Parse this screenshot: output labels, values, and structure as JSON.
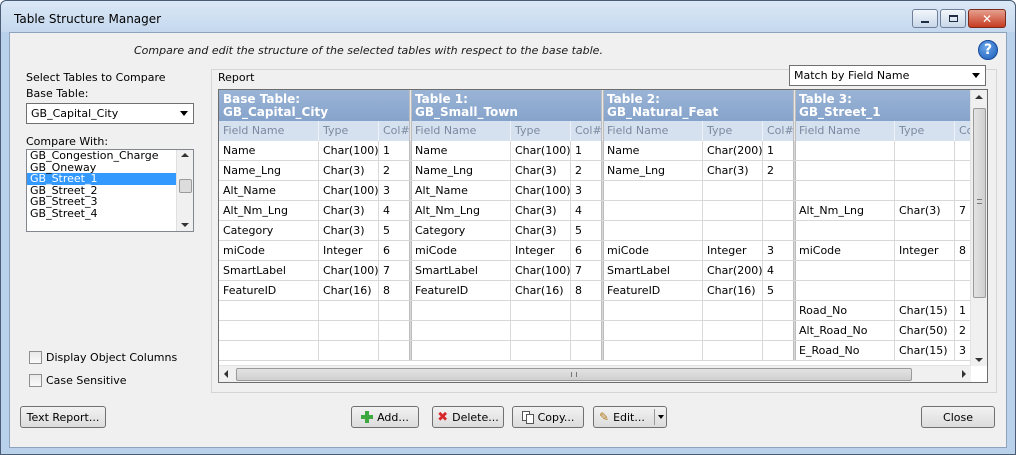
{
  "window": {
    "title": "Table Structure Manager"
  },
  "subtitle": "Compare and edit the structure of the selected tables with respect to the base table.",
  "left": {
    "select_label": "Select Tables to Compare",
    "base_table_label": "Base Table:",
    "base_table_value": "GB_Capital_City",
    "compare_with_label": "Compare With:",
    "compare_items": [
      "GB_Congestion_Charge",
      "GB_Oneway",
      "GB_Street_1",
      "GB_Street_2",
      "GB_Street_3",
      "GB_Street_4"
    ],
    "selected_item": "GB_Street_1",
    "display_object_columns": "Display Object Columns",
    "case_sensitive": "Case Sensitive"
  },
  "report": {
    "label": "Report",
    "match_by": "Match by Field Name",
    "tables": [
      {
        "title": "Base Table:",
        "name": "GB_Capital_City"
      },
      {
        "title": "Table 1:",
        "name": "GB_Small_Town"
      },
      {
        "title": "Table 2:",
        "name": "GB_Natural_Feat"
      },
      {
        "title": "Table 3:",
        "name": "GB_Street_1"
      }
    ],
    "columns": {
      "field": "Field Name",
      "type": "Type",
      "col": "Col#",
      "col_cut": "Co"
    },
    "rows": [
      [
        [
          "Name",
          "Char(100)",
          "1"
        ],
        [
          "Name",
          "Char(100)",
          "1"
        ],
        [
          "Name",
          "Char(200)",
          "1"
        ],
        [
          "",
          "",
          ""
        ]
      ],
      [
        [
          "Name_Lng",
          "Char(3)",
          "2"
        ],
        [
          "Name_Lng",
          "Char(3)",
          "2"
        ],
        [
          "Name_Lng",
          "Char(3)",
          "2"
        ],
        [
          "",
          "",
          ""
        ]
      ],
      [
        [
          "Alt_Name",
          "Char(100)",
          "3"
        ],
        [
          "Alt_Name",
          "Char(100)",
          "3"
        ],
        [
          "",
          "",
          ""
        ],
        [
          "",
          "",
          ""
        ]
      ],
      [
        [
          "Alt_Nm_Lng",
          "Char(3)",
          "4"
        ],
        [
          "Alt_Nm_Lng",
          "Char(3)",
          "4"
        ],
        [
          "",
          "",
          ""
        ],
        [
          "Alt_Nm_Lng",
          "Char(3)",
          "7"
        ]
      ],
      [
        [
          "Category",
          "Char(3)",
          "5"
        ],
        [
          "Category",
          "Char(3)",
          "5"
        ],
        [
          "",
          "",
          ""
        ],
        [
          "",
          "",
          ""
        ]
      ],
      [
        [
          "miCode",
          "Integer",
          "6"
        ],
        [
          "miCode",
          "Integer",
          "6"
        ],
        [
          "miCode",
          "Integer",
          "3"
        ],
        [
          "miCode",
          "Integer",
          "8"
        ]
      ],
      [
        [
          "SmartLabel",
          "Char(100)",
          "7"
        ],
        [
          "SmartLabel",
          "Char(100)",
          "7"
        ],
        [
          "SmartLabel",
          "Char(200)",
          "4"
        ],
        [
          "",
          "",
          ""
        ]
      ],
      [
        [
          "FeatureID",
          "Char(16)",
          "8"
        ],
        [
          "FeatureID",
          "Char(16)",
          "8"
        ],
        [
          "FeatureID",
          "Char(16)",
          "5"
        ],
        [
          "",
          "",
          ""
        ]
      ],
      [
        [
          "",
          "",
          ""
        ],
        [
          "",
          "",
          ""
        ],
        [
          "",
          "",
          ""
        ],
        [
          "Road_No",
          "Char(15)",
          "1"
        ]
      ],
      [
        [
          "",
          "",
          ""
        ],
        [
          "",
          "",
          ""
        ],
        [
          "",
          "",
          ""
        ],
        [
          "Alt_Road_No",
          "Char(50)",
          "2"
        ]
      ],
      [
        [
          "",
          "",
          ""
        ],
        [
          "",
          "",
          ""
        ],
        [
          "",
          "",
          ""
        ],
        [
          "E_Road_No",
          "Char(15)",
          "3"
        ]
      ]
    ]
  },
  "buttons": {
    "text_report": "Text Report...",
    "add": "Add...",
    "delete": "Delete...",
    "copy": "Copy...",
    "edit": "Edit...",
    "close": "Close"
  },
  "icons": {
    "add": "plus-icon",
    "delete": "x-icon",
    "copy": "copy-icon",
    "edit": "pencil-icon",
    "help": "question-icon"
  },
  "colors": {
    "header_bg": "#8fa9cf",
    "subheader_bg": "#d6e1ef",
    "selection": "#3399ff",
    "add_green": "#3da83d",
    "delete_red": "#d8272a"
  }
}
